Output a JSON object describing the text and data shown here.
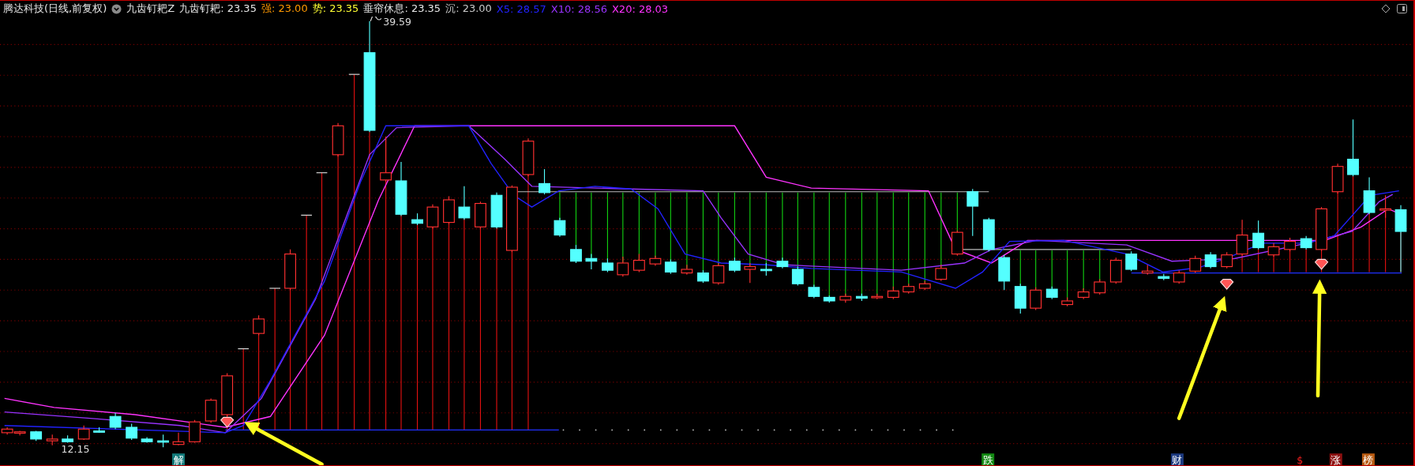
{
  "header": {
    "title": "腾达科技(日线,前复权)",
    "indicator_name": "九齿钉耙Z",
    "values": [
      {
        "text": "九齿钉耙: 23.35",
        "color": "#e6e6e6"
      },
      {
        "text": "强: 23.00",
        "color": "#ff9900"
      },
      {
        "text": "势: 23.35",
        "color": "#ffff33"
      },
      {
        "text": "垂帘休息: 23.35",
        "color": "#e6e6e6"
      },
      {
        "text": "沉: 23.00",
        "color": "#c8c8c8"
      },
      {
        "text": "X5: 28.57",
        "color": "#2222ff"
      },
      {
        "text": "X10: 28.56",
        "color": "#9933ff"
      },
      {
        "text": "X20: 28.03",
        "color": "#ff33ff"
      }
    ]
  },
  "chart": {
    "high_label": "39.59",
    "low_label": "12.15"
  },
  "markers": [
    {
      "text": "解",
      "color": "#127a7a"
    },
    {
      "text": "跌",
      "color": "#138a13"
    },
    {
      "text": "财",
      "color": "#1c3a80"
    },
    {
      "text": "$",
      "color": "#ff2020",
      "kind": "text"
    },
    {
      "text": "涨",
      "color": "#8a1010"
    },
    {
      "text": "榜",
      "color": "#b85a10"
    }
  ]
}
